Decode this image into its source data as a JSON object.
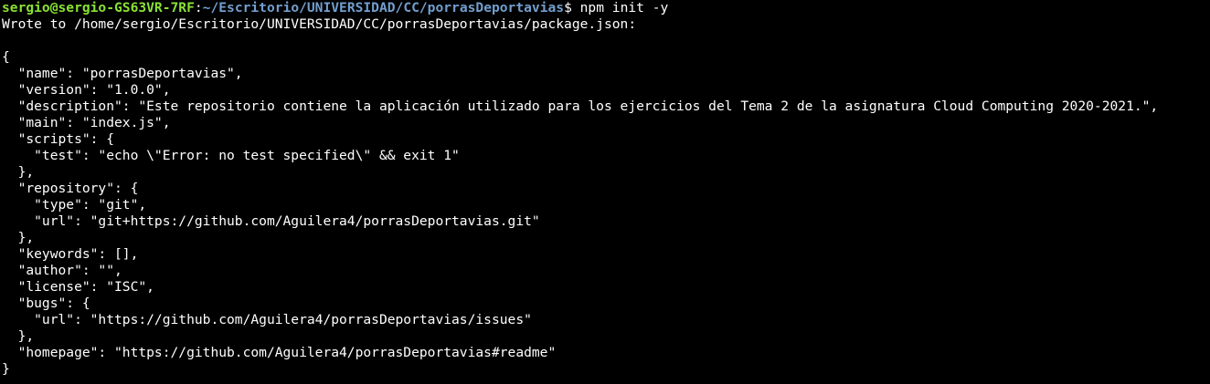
{
  "prompt": {
    "user_host": "sergio@sergio-GS63VR-7RF",
    "separator": ":",
    "path": "~/Escritorio/UNIVERSIDAD/CC/porrasDeportavias",
    "symbol": "$ ",
    "command": "npm init -y"
  },
  "output": {
    "wrote_line": "Wrote to /home/sergio/Escritorio/UNIVERSIDAD/CC/porrasDeportavias/package.json:",
    "blank_line": "",
    "json_lines": [
      "{",
      "  \"name\": \"porrasDeportavias\",",
      "  \"version\": \"1.0.0\",",
      "  \"description\": \"Este repositorio contiene la aplicación utilizado para los ejercicios del Tema 2 de la asignatura Cloud Computing 2020-2021.\",",
      "  \"main\": \"index.js\",",
      "  \"scripts\": {",
      "    \"test\": \"echo \\\"Error: no test specified\\\" && exit 1\"",
      "  },",
      "  \"repository\": {",
      "    \"type\": \"git\",",
      "    \"url\": \"git+https://github.com/Aguilera4/porrasDeportavias.git\"",
      "  },",
      "  \"keywords\": [],",
      "  \"author\": \"\",",
      "  \"license\": \"ISC\",",
      "  \"bugs\": {",
      "    \"url\": \"https://github.com/Aguilera4/porrasDeportavias/issues\"",
      "  },",
      "  \"homepage\": \"https://github.com/Aguilera4/porrasDeportavias#readme\"",
      "}"
    ]
  },
  "colors": {
    "background": "#000000",
    "text": "#ffffff",
    "user_host": "#8ae234",
    "path": "#729fcf"
  }
}
